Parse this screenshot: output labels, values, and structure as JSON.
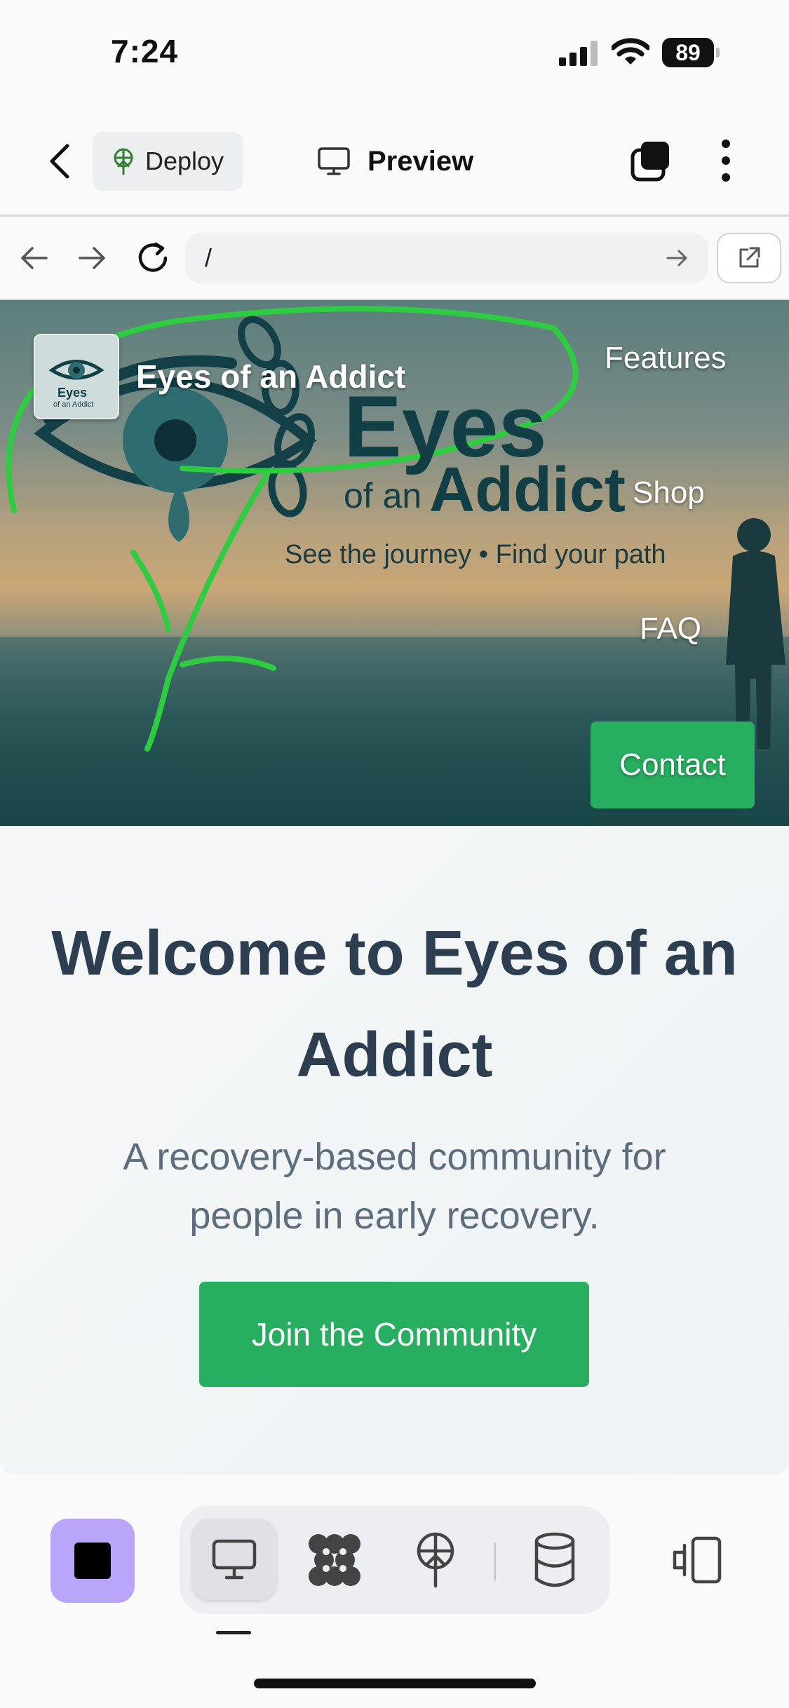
{
  "status_bar": {
    "time": "7:24",
    "battery": "89"
  },
  "app_bar": {
    "deploy_label": "Deploy",
    "preview_label": "Preview",
    "icons": [
      "chevron-left-icon",
      "deploy-icon",
      "monitor-icon",
      "tabs-icon",
      "more-vertical-icon"
    ]
  },
  "browser": {
    "url": "/",
    "icons": [
      "arrow-left-icon",
      "arrow-right-icon",
      "reload-icon",
      "arrow-go-icon",
      "external-link-icon"
    ]
  },
  "site": {
    "brand": "Eyes of an Addict",
    "logo_badge_line1": "Eyes",
    "logo_badge_line2": "of an Addict",
    "nav": {
      "features": "Features",
      "shop": "Shop",
      "faq": "FAQ",
      "contact": "Contact"
    },
    "hero_logo": {
      "eyes": "Eyes",
      "of_an": "of an",
      "addict": "Addict",
      "tagline": "See the journey • Find your path"
    },
    "welcome_title": "Welcome to Eyes of an Addict",
    "welcome_subtitle": "A recovery-based community for people in early recovery.",
    "cta": "Join the Community"
  },
  "toolbar": {
    "icons": [
      "stop-icon",
      "desktop-icon",
      "nodes-icon",
      "deploy-icon",
      "database-icon",
      "device-icon"
    ]
  },
  "colors": {
    "accent_green": "#27ae60",
    "title_color": "#2c3e50",
    "stop_button": "#b9a6fb",
    "annotation_green": "#2ecc40"
  }
}
